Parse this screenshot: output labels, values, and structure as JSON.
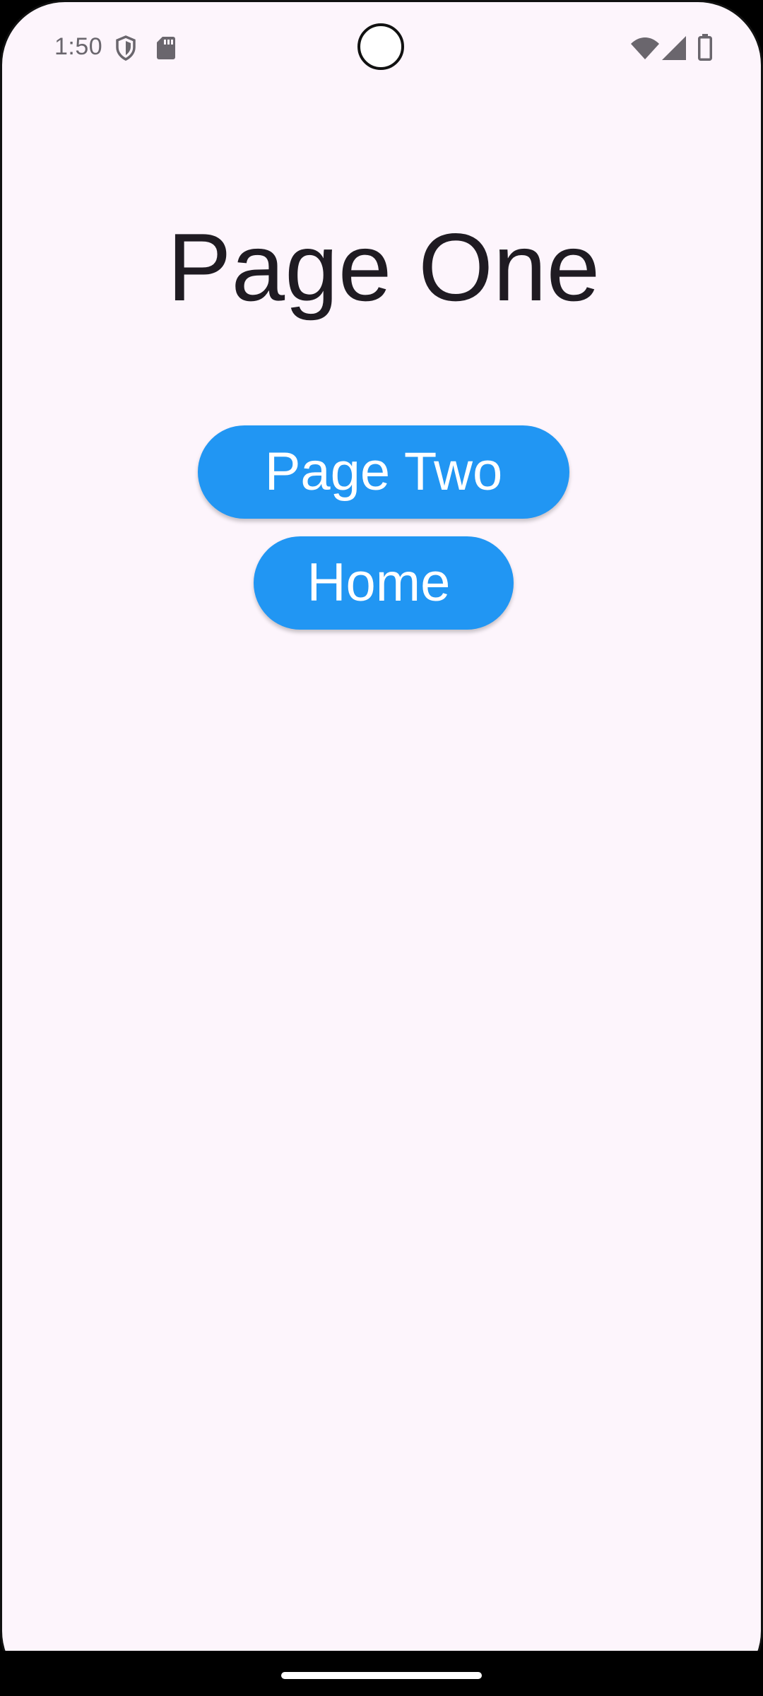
{
  "status_bar": {
    "time": "1:50",
    "icons": [
      "shield-icon",
      "sd-card-icon",
      "wifi-icon",
      "signal-icon",
      "battery-icon"
    ]
  },
  "main": {
    "title": "Page One",
    "buttons": {
      "page_two": "Page Two",
      "home": "Home"
    }
  },
  "colors": {
    "background": "#fdf5fc",
    "button": "#2196f3",
    "button_text": "#ffffff",
    "title_text": "#1f1b22",
    "status_icons": "#6a666d"
  }
}
